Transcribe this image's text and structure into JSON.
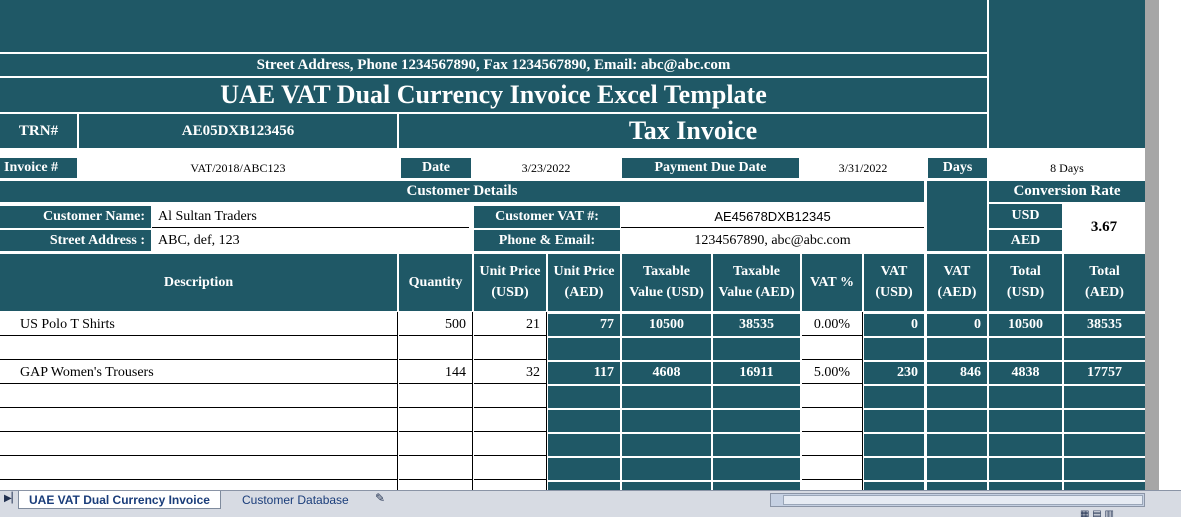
{
  "company": {
    "address_line": "Street Address, Phone 1234567890, Fax 1234567890, Email: abc@abc.com",
    "template_title": "UAE VAT Dual Currency Invoice Excel Template"
  },
  "trn": {
    "label": "TRN#",
    "value": "AE05DXB123456"
  },
  "tax_invoice_label": "Tax Invoice",
  "invoice": {
    "number_label": "Invoice #",
    "number_value": "VAT/2018/ABC123",
    "date_label": "Date",
    "date_value": "3/23/2022",
    "due_label": "Payment Due Date",
    "due_value": "3/31/2022",
    "days_label": "Days",
    "days_value": "8 Days"
  },
  "customer": {
    "section_title": "Customer Details",
    "name_label": "Customer Name:",
    "name_value": "Al Sultan Traders",
    "address_label": "Street Address :",
    "address_value": "ABC, def, 123",
    "vat_label": "Customer VAT #:",
    "vat_value": "AE45678DXB12345",
    "contact_label": "Phone & Email:",
    "contact_value": "1234567890, abc@abc.com"
  },
  "conversion": {
    "title": "Conversion Rate",
    "usd_label": "USD",
    "aed_label": "AED",
    "rate": "3.67"
  },
  "table": {
    "headers": {
      "description": "Description",
      "quantity": "Quantity",
      "unit_price_usd_1": "Unit Price",
      "unit_price_usd_2": "(USD)",
      "unit_price_aed_1": "Unit Price",
      "unit_price_aed_2": "(AED)",
      "taxable_usd_1": "Taxable",
      "taxable_usd_2": "Value (USD)",
      "taxable_aed_1": "Taxable",
      "taxable_aed_2": "Value (AED)",
      "vat_pct": "VAT %",
      "vat_usd_1": "VAT",
      "vat_usd_2": "(USD)",
      "vat_aed_1": "VAT",
      "vat_aed_2": "(AED)",
      "total_usd_1": "Total",
      "total_usd_2": "(USD)",
      "total_aed_1": "Total",
      "total_aed_2": "(AED)"
    },
    "rows": [
      {
        "description": "US Polo T Shirts",
        "quantity": "500",
        "unit_usd": "21",
        "unit_aed": "77",
        "taxable_usd": "10500",
        "taxable_aed": "38535",
        "vat_pct": "0.00%",
        "vat_usd": "0",
        "vat_aed": "0",
        "total_usd": "10500",
        "total_aed": "38535"
      },
      {
        "description": "",
        "quantity": "",
        "unit_usd": "",
        "unit_aed": "",
        "taxable_usd": "",
        "taxable_aed": "",
        "vat_pct": "",
        "vat_usd": "",
        "vat_aed": "",
        "total_usd": "",
        "total_aed": ""
      },
      {
        "description": "GAP Women's Trousers",
        "quantity": "144",
        "unit_usd": "32",
        "unit_aed": "117",
        "taxable_usd": "4608",
        "taxable_aed": "16911",
        "vat_pct": "5.00%",
        "vat_usd": "230",
        "vat_aed": "846",
        "total_usd": "4838",
        "total_aed": "17757"
      },
      {
        "description": "",
        "quantity": "",
        "unit_usd": "",
        "unit_aed": "",
        "taxable_usd": "",
        "taxable_aed": "",
        "vat_pct": "",
        "vat_usd": "",
        "vat_aed": "",
        "total_usd": "",
        "total_aed": ""
      },
      {
        "description": "",
        "quantity": "",
        "unit_usd": "",
        "unit_aed": "",
        "taxable_usd": "",
        "taxable_aed": "",
        "vat_pct": "",
        "vat_usd": "",
        "vat_aed": "",
        "total_usd": "",
        "total_aed": ""
      },
      {
        "description": "",
        "quantity": "",
        "unit_usd": "",
        "unit_aed": "",
        "taxable_usd": "",
        "taxable_aed": "",
        "vat_pct": "",
        "vat_usd": "",
        "vat_aed": "",
        "total_usd": "",
        "total_aed": ""
      },
      {
        "description": "",
        "quantity": "",
        "unit_usd": "",
        "unit_aed": "",
        "taxable_usd": "",
        "taxable_aed": "",
        "vat_pct": "",
        "vat_usd": "",
        "vat_aed": "",
        "total_usd": "",
        "total_aed": ""
      },
      {
        "description": "",
        "quantity": "",
        "unit_usd": "",
        "unit_aed": "",
        "taxable_usd": "",
        "taxable_aed": "",
        "vat_pct": "",
        "vat_usd": "",
        "vat_aed": "",
        "total_usd": "",
        "total_aed": ""
      }
    ]
  },
  "sheet_tabs": [
    {
      "label": "UAE VAT Dual Currency Invoice",
      "active": true
    },
    {
      "label": "Customer Database",
      "active": false
    }
  ],
  "colors": {
    "header_teal": "#1f5866",
    "tab_text": "#1a3d7a"
  },
  "icons": {
    "new_sheet": "new-sheet-icon",
    "nav_first": "first-sheet-icon",
    "nav_prev": "prev-sheet-icon"
  }
}
